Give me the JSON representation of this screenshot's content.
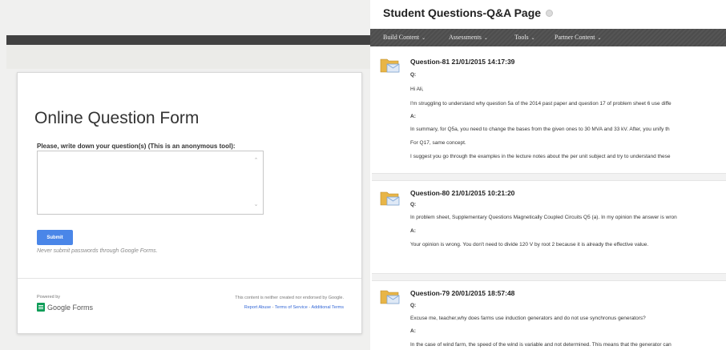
{
  "form": {
    "title": "Online Question Form",
    "question_label": "Please, write down your question(s) (This is an anonymous tool):",
    "textarea_value": "",
    "submit_label": "Submit",
    "password_note": "Never submit passwords through Google Forms.",
    "powered_by": "Powered by",
    "google_forms": "Google Forms",
    "disclaimer": "This content is neither created nor endorsed by Google.",
    "links": [
      "Report Abuse",
      "Terms of Service",
      "Additional Terms"
    ],
    "link_separator": " - "
  },
  "qa": {
    "page_title": "Student Questions-Q&A Page",
    "nav": [
      {
        "label": "Build Content"
      },
      {
        "label": "Assessments"
      },
      {
        "label": "Tools"
      },
      {
        "label": "Partner Content"
      }
    ],
    "items": [
      {
        "title": "Question-81 21/01/2015 14:17:39",
        "q_label": "Q:",
        "q_lines": [
          "Hi Ali,",
          "I'm struggling to understand why question 5a of the 2014 past paper and question 17 of problem sheet 6 use diffe"
        ],
        "a_label": "A:",
        "a_lines": [
          "In summary, for Q5a, you need to change the bases from the given ones to 30 MVA and 33 kV. After, you unify th",
          "For Q17, same concept.",
          "I suggest you go through the examples in the lecture notes about the per unit subject and try to understand these"
        ]
      },
      {
        "title": "Question-80 21/01/2015 10:21:20",
        "q_label": "Q:",
        "q_lines": [
          "In problem sheet, Supplementary Questions Magnetically Coupled Circuits Q5 (a). In my opinion the answer is wron"
        ],
        "a_label": "A:",
        "a_lines": [
          "Your opinion is wrong. You don't need to divide 120 V by root 2 because it is already the effective value."
        ]
      },
      {
        "title": "Question-79 20/01/2015 18:57:48",
        "q_label": "Q:",
        "q_lines": [
          "Excuse me, teacher,why does farms use induction generators and do not use synchronus generators?"
        ],
        "a_label": "A:",
        "a_lines": [
          "In the case of wind farm, the speed of the wind is variable and not determined. This means that the generator can"
        ]
      }
    ]
  },
  "colors": {
    "submit_blue": "#4a86e8",
    "link_blue": "#3367d6",
    "forms_green": "#0f9d58",
    "nav_dark": "#4d4d4d",
    "folder_yellow": "#e8b547",
    "envelope_blue": "#7fa6d6"
  },
  "icons": {
    "item_icon": "folder-envelope-icon",
    "title_icon": "options-circle-icon",
    "nav_chevron": "chevron-down-icon",
    "forms_logo": "google-forms-icon"
  }
}
